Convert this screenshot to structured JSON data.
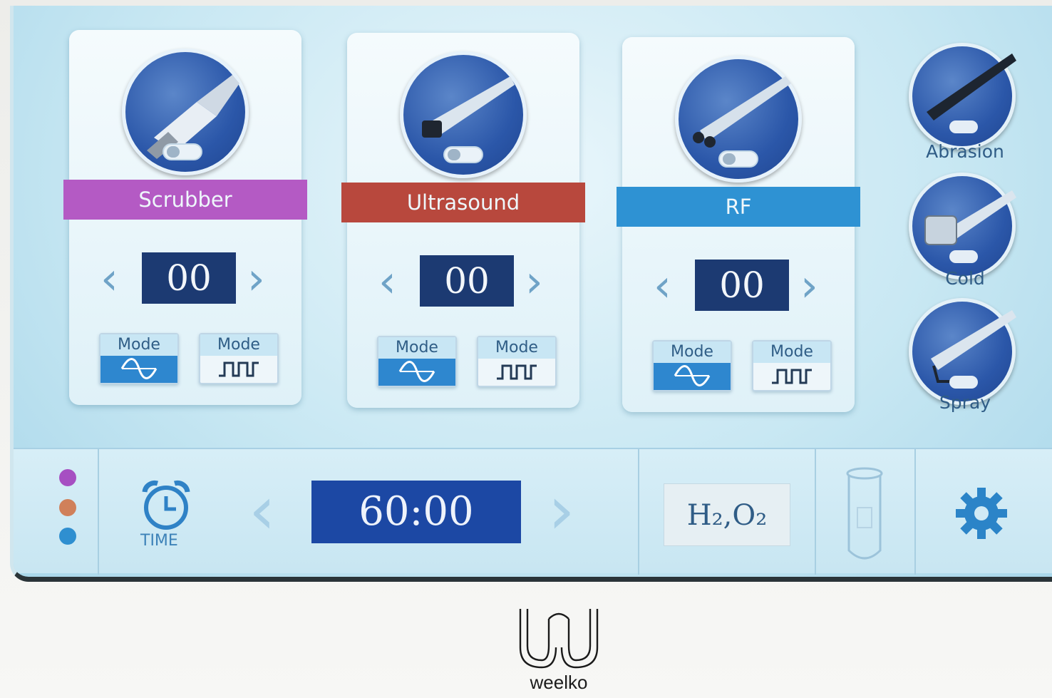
{
  "cards": [
    {
      "label": "Scrubber",
      "value": "00",
      "mode1": "Mode",
      "mode2": "Mode",
      "color": "#b45ac4"
    },
    {
      "label": "Ultrasound",
      "value": "00",
      "mode1": "Mode",
      "mode2": "Mode",
      "color": "#b8483d"
    },
    {
      "label": "RF",
      "value": "00",
      "mode1": "Mode",
      "mode2": "Mode",
      "color": "#2e92d3"
    }
  ],
  "accessories": [
    {
      "label": "Abrasion",
      "icon": "abrasion-handpiece-icon"
    },
    {
      "label": "Cold",
      "icon": "cold-hammer-handpiece-icon"
    },
    {
      "label": "Spray",
      "icon": "spray-handpiece-icon"
    }
  ],
  "status_dots": [
    "#a64fc2",
    "#d0805a",
    "#2f8fd0"
  ],
  "time": {
    "label": "TIME",
    "value": "60:00"
  },
  "gas": "H₂,O₂",
  "icons": {
    "timer": "alarm-clock-icon",
    "bottle": "test-tube-icon",
    "settings": "gear-icon"
  },
  "brand": "weelko"
}
